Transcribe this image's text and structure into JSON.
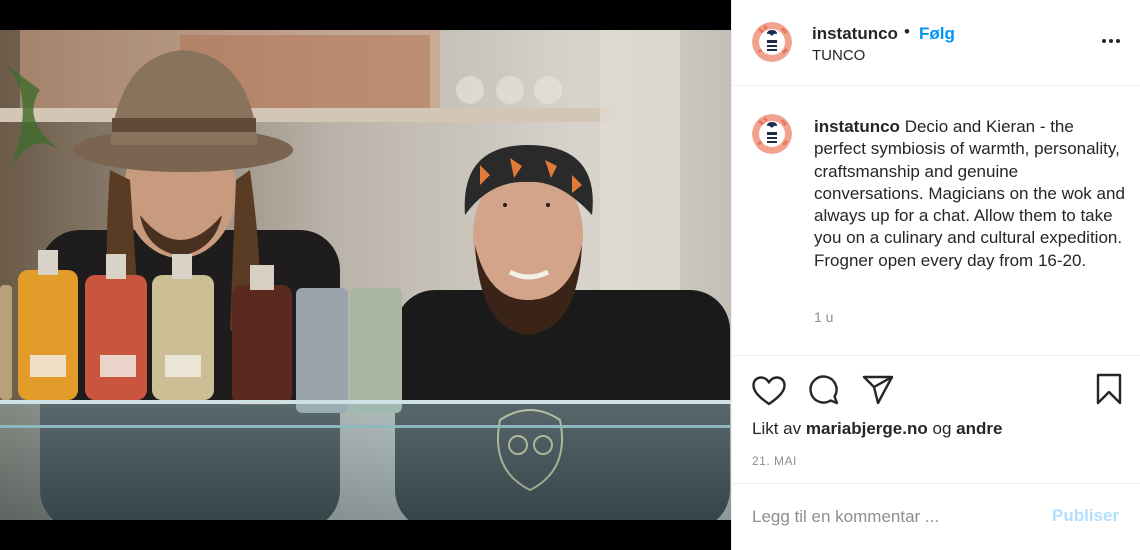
{
  "post": {
    "username": "instatunco",
    "separator": "•",
    "follow_label": "Følg",
    "location": "TUNCO",
    "caption": "Decio and Kieran - the perfect symbiosis of warmth, personality, craftsmanship and genuine conversations. Magicians on the wok and always up for a chat. Allow them to take you on a culinary and cultural expedition. Frogner open every day from 16-20.",
    "age": "1 u",
    "liked_prefix": "Likt av",
    "liked_user": "mariabjerge.no",
    "liked_joiner": "og",
    "liked_others": "andre",
    "date": "21. MAI"
  },
  "comment": {
    "placeholder": "Legg til en kommentar ...",
    "post_label": "Publiser"
  },
  "icons": {
    "more": "more-options-icon",
    "like": "heart-icon",
    "comment": "comment-bubble-icon",
    "share": "paper-plane-icon",
    "save": "bookmark-icon"
  },
  "colors": {
    "link_blue": "#0095f6",
    "disabled_blue": "#b2dffc",
    "muted_text": "#8e8e8e",
    "text": "#262626",
    "divider": "#efefef"
  }
}
